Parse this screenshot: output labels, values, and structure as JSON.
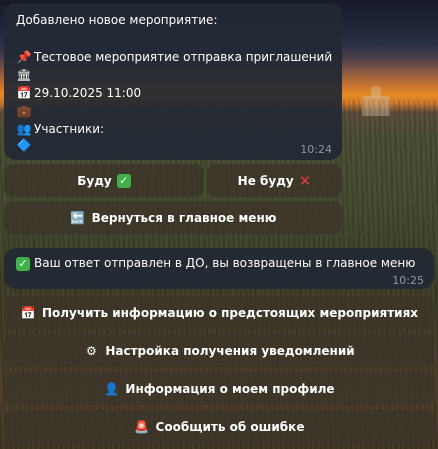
{
  "message1": {
    "header": "Добавлено новое мероприятие:",
    "pin_icon": "pushpin-icon",
    "title": "Тестовое мероприятие отправка приглашений",
    "building_icon": "classical-building-icon",
    "calendar_icon": "calendar-icon",
    "datetime": "29.10.2025 11:00",
    "person_icon": "person-icon",
    "participants_icon": "two-people-icon",
    "participants_label": "Участники:",
    "diamond_icon": "blue-diamond-icon",
    "time": "10:24"
  },
  "inline_keyboard": {
    "yes_label": "Буду",
    "no_label": "Не буду",
    "back_label": "Вернуться в главное меню"
  },
  "message2": {
    "text": "Ваш ответ отправлен в ДО, вы возвращены в главное меню",
    "time": "10:25"
  },
  "main_menu": {
    "upcoming_label": "Получить информацию о предстоящих мероприятиях",
    "notifications_label": "Настройка получения уведомлений",
    "profile_label": "Информация о моем профиле",
    "report_label": "Сообщить об ошибке"
  },
  "colors": {
    "bubble_bg": "#222934",
    "button_bg": "#3c352a",
    "timestamp": "#8d98a6",
    "check_green": "#3fb24a",
    "cross_red": "#e23b3b"
  }
}
